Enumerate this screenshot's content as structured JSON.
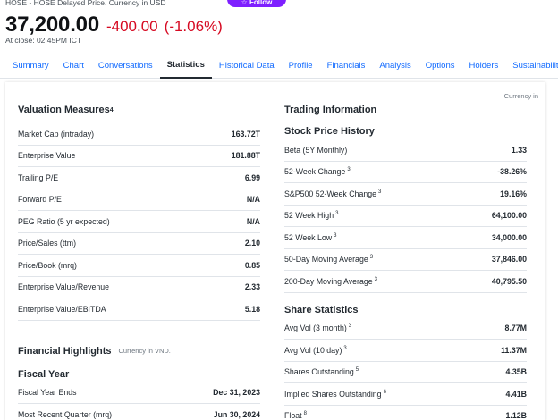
{
  "header": {
    "source": "HOSE - HOSE Delayed Price. Currency in USD",
    "follow_label": "☆ Follow",
    "price": "37,200.00",
    "change": "-400.00",
    "change_pct": "(-1.06%)",
    "close_time": "At close: 02:45PM ICT",
    "accent_color": "#7e1fff",
    "negative_color": "#d60a22"
  },
  "tabs": [
    {
      "label": "Summary"
    },
    {
      "label": "Chart"
    },
    {
      "label": "Conversations"
    },
    {
      "label": "Statistics",
      "active": true
    },
    {
      "label": "Historical Data"
    },
    {
      "label": "Profile"
    },
    {
      "label": "Financials"
    },
    {
      "label": "Analysis"
    },
    {
      "label": "Options"
    },
    {
      "label": "Holders"
    },
    {
      "label": "Sustainability"
    }
  ],
  "currency_note": "Currency in",
  "valuation": {
    "title": "Valuation Measures",
    "title_sup": "4",
    "rows": [
      {
        "label": "Market Cap (intraday)",
        "sup": "",
        "value": "163.72T"
      },
      {
        "label": "Enterprise Value",
        "sup": "",
        "value": "181.88T"
      },
      {
        "label": "Trailing P/E",
        "sup": "",
        "value": "6.99"
      },
      {
        "label": "Forward P/E",
        "sup": "",
        "value": "N/A"
      },
      {
        "label": "PEG Ratio (5 yr expected)",
        "sup": "",
        "value": "N/A"
      },
      {
        "label": "Price/Sales (ttm)",
        "sup": "",
        "value": "2.10"
      },
      {
        "label": "Price/Book (mrq)",
        "sup": "",
        "value": "0.85"
      },
      {
        "label": "Enterprise Value/Revenue",
        "sup": "",
        "value": "2.33"
      },
      {
        "label": "Enterprise Value/EBITDA",
        "sup": "",
        "value": "5.18"
      }
    ]
  },
  "financial_highlights": {
    "title": "Financial Highlights",
    "note": "Currency in VND.",
    "fiscal_year": {
      "title": "Fiscal Year",
      "rows": [
        {
          "label": "Fiscal Year Ends",
          "sup": "",
          "value": "Dec 31, 2023"
        },
        {
          "label": "Most Recent Quarter (mrq)",
          "sup": "",
          "value": "Jun 30, 2024"
        }
      ]
    }
  },
  "trading": {
    "title": "Trading Information",
    "stock_price_history": {
      "title": "Stock Price History",
      "rows": [
        {
          "label": "Beta (5Y Monthly)",
          "sup": "",
          "value": "1.33"
        },
        {
          "label": "52-Week Change",
          "sup": "3",
          "value": "-38.26%"
        },
        {
          "label": "S&P500 52-Week Change",
          "sup": "3",
          "value": "19.16%"
        },
        {
          "label": "52 Week High",
          "sup": "3",
          "value": "64,100.00"
        },
        {
          "label": "52 Week Low",
          "sup": "3",
          "value": "34,000.00"
        },
        {
          "label": "50-Day Moving Average",
          "sup": "3",
          "value": "37,846.00"
        },
        {
          "label": "200-Day Moving Average",
          "sup": "3",
          "value": "40,795.50"
        }
      ]
    },
    "share_statistics": {
      "title": "Share Statistics",
      "rows": [
        {
          "label": "Avg Vol (3 month)",
          "sup": "3",
          "value": "8.77M"
        },
        {
          "label": "Avg Vol (10 day)",
          "sup": "3",
          "value": "11.37M"
        },
        {
          "label": "Shares Outstanding",
          "sup": "5",
          "value": "4.35B"
        },
        {
          "label": "Implied Shares Outstanding",
          "sup": "6",
          "value": "4.41B"
        },
        {
          "label": "Float",
          "sup": "8",
          "value": "1.12B"
        }
      ]
    }
  }
}
